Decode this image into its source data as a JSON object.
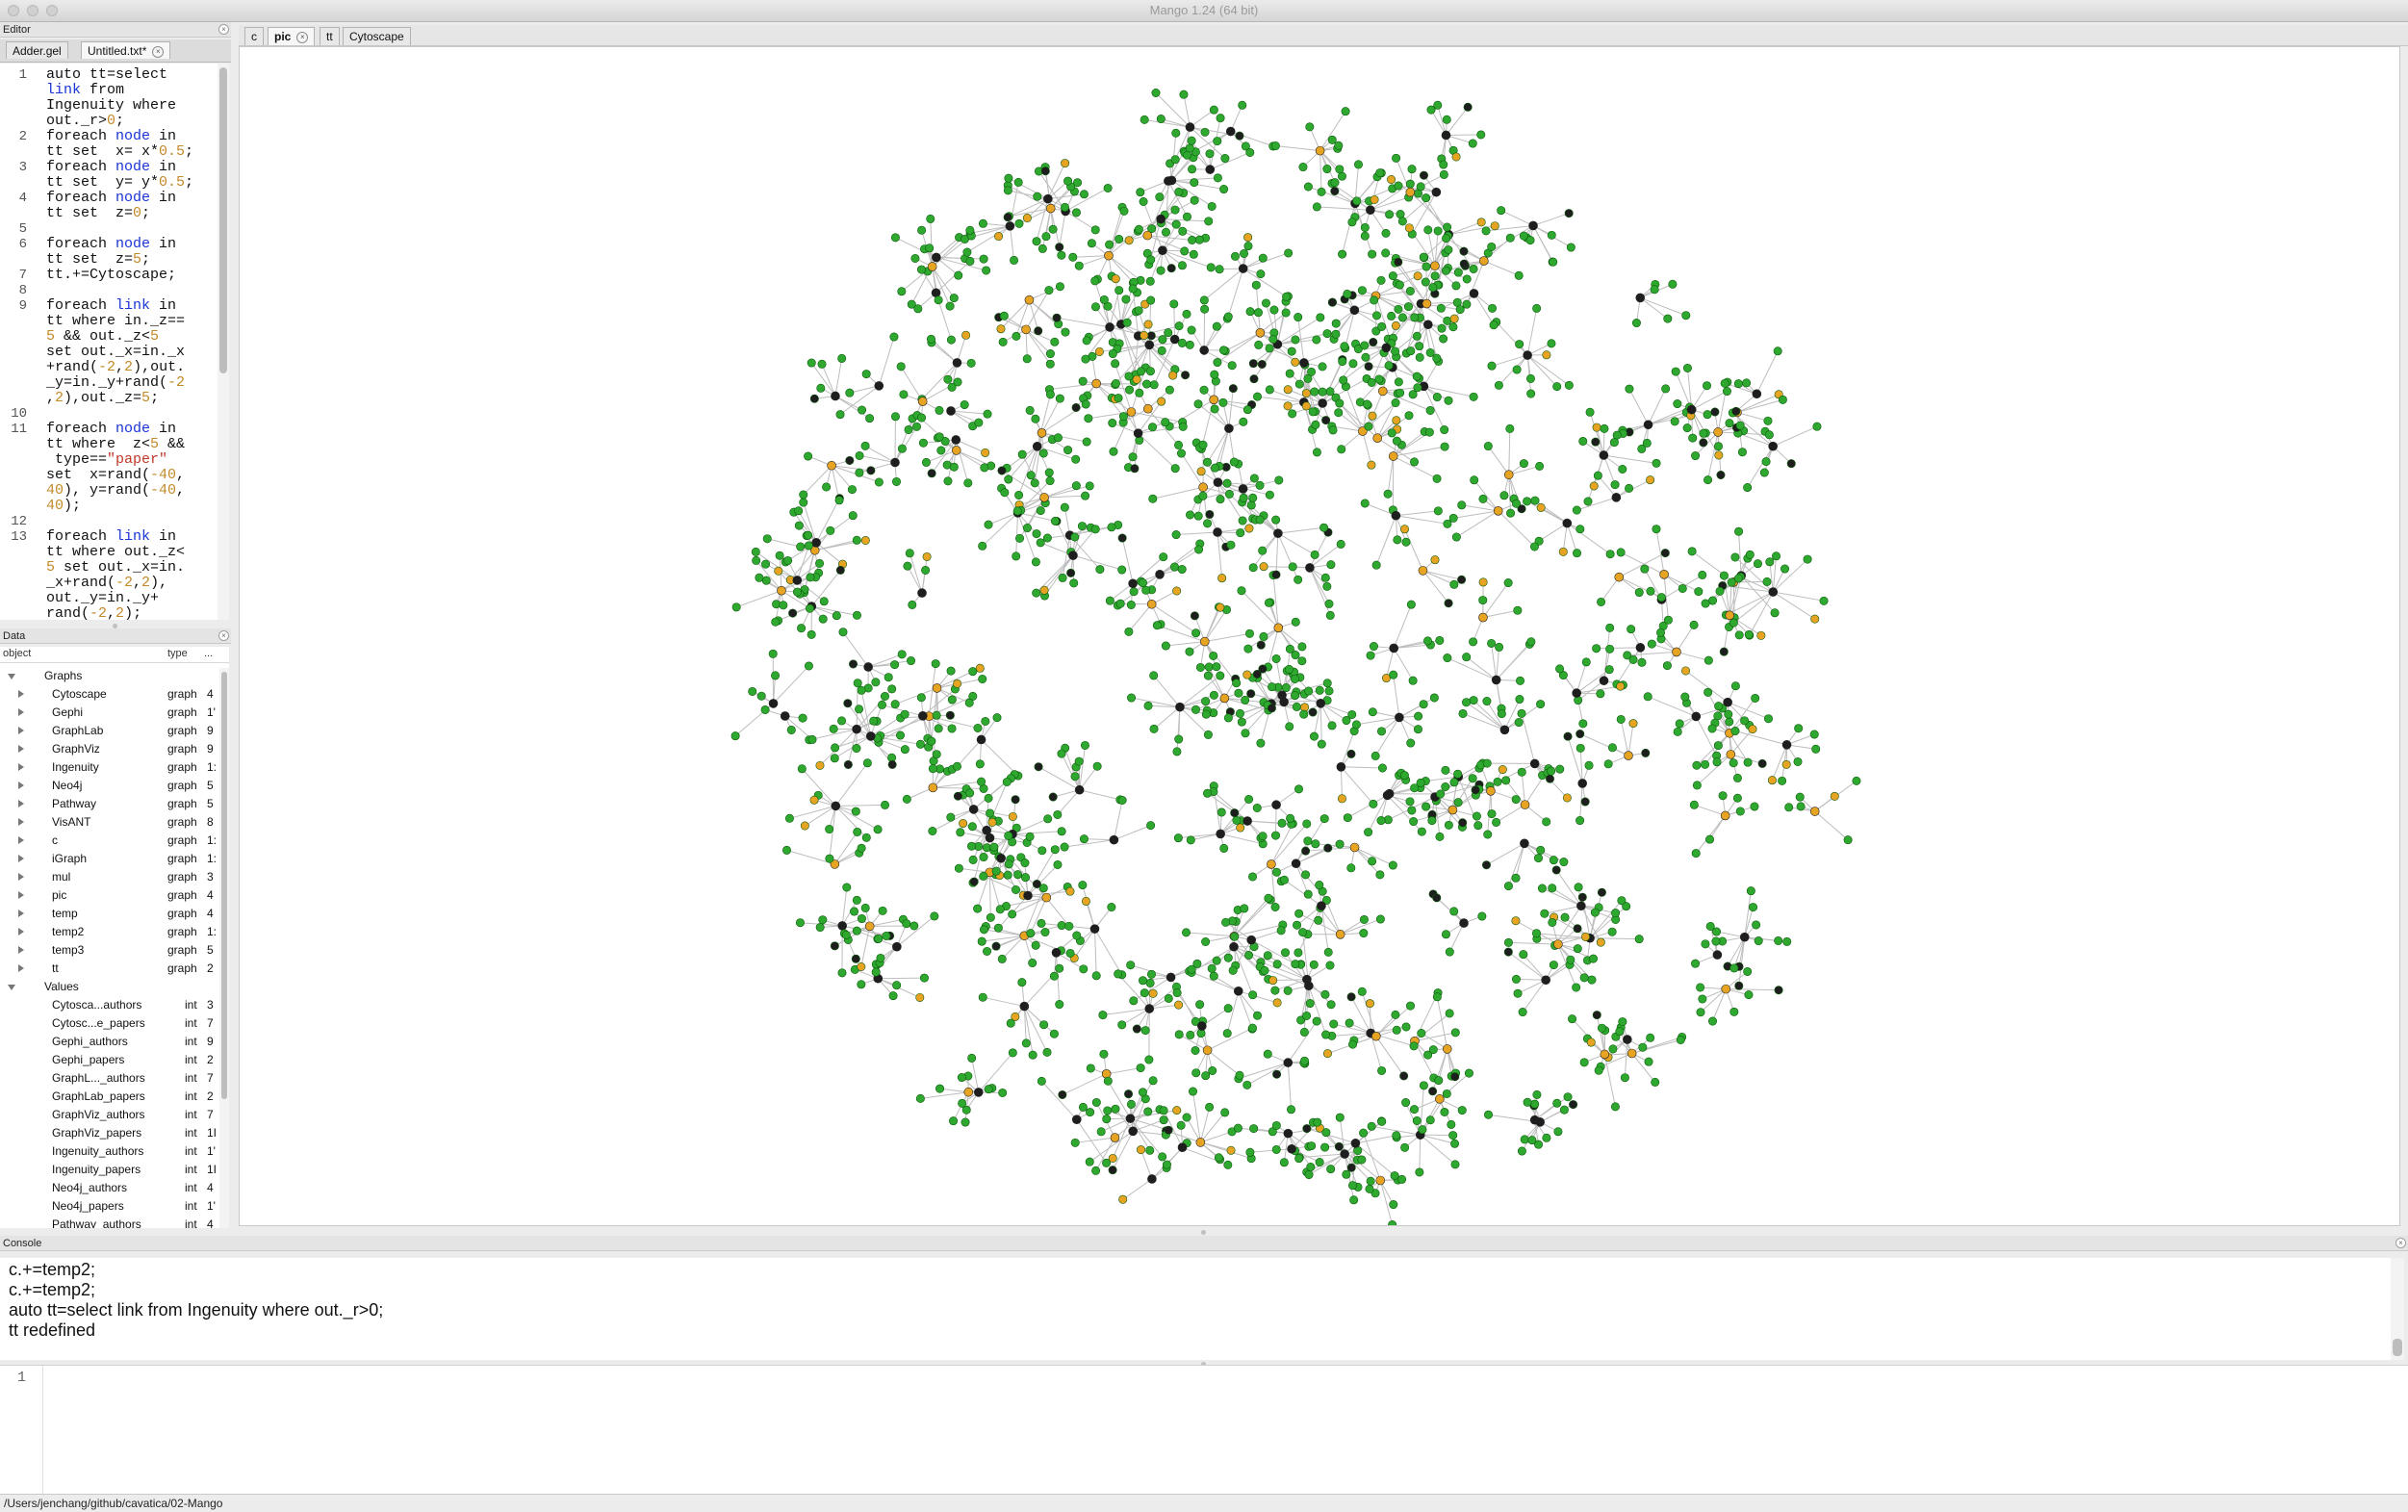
{
  "window": {
    "title": "Mango 1.24 (64 bit)"
  },
  "editor": {
    "panel_title": "Editor",
    "tabs": [
      {
        "label": "Adder.gel"
      },
      {
        "label": "Untitled.txt*"
      }
    ],
    "line_numbers": [
      "1",
      "2",
      "3",
      "4",
      "5",
      "6",
      "7",
      "8",
      "9",
      "10",
      "11",
      "12",
      "13"
    ],
    "code_lines": [
      "auto tt=select",
      "link from",
      "Ingenuity where",
      "out._r>0;",
      "foreach node in",
      "tt set  x= x*0.5;",
      "foreach node in",
      "tt set  y= y*0.5;",
      "foreach node in",
      "tt set  z=0;",
      "",
      "foreach node in",
      "tt set  z=5;",
      "tt.+=Cytoscape;",
      "",
      "foreach link in",
      "tt where in._z==",
      "5 && out._z<5",
      "set out._x=in._x",
      "+rand(-2,2),out.",
      "_y=in._y+rand(-2",
      ",2),out._z=5;",
      "",
      "foreach node in",
      "tt where  z<5 &&",
      " type==\"paper\"",
      "set  x=rand(-40,",
      "40), y=rand(-40,",
      "40);",
      "",
      "foreach link in",
      "tt where out._z<",
      "5 set out._x=in.",
      "_x+rand(-2,2),",
      "out._y=in._y+",
      "rand(-2,2);"
    ]
  },
  "data_panel": {
    "panel_title": "Data",
    "col_object": "object",
    "col_type": "type",
    "col_more": "...",
    "groups": [
      {
        "label": "Graphs"
      },
      {
        "label": "Values"
      }
    ],
    "graphs": [
      {
        "name": "Cytoscape",
        "type": "graph",
        "val": "4"
      },
      {
        "name": "Gephi",
        "type": "graph",
        "val": "1'"
      },
      {
        "name": "GraphLab",
        "type": "graph",
        "val": "9"
      },
      {
        "name": "GraphViz",
        "type": "graph",
        "val": "9"
      },
      {
        "name": "Ingenuity",
        "type": "graph",
        "val": "1:"
      },
      {
        "name": "Neo4j",
        "type": "graph",
        "val": "5"
      },
      {
        "name": "Pathway",
        "type": "graph",
        "val": "5"
      },
      {
        "name": "VisANT",
        "type": "graph",
        "val": "8"
      },
      {
        "name": "c",
        "type": "graph",
        "val": "1:"
      },
      {
        "name": "iGraph",
        "type": "graph",
        "val": "1:"
      },
      {
        "name": "mul",
        "type": "graph",
        "val": "3"
      },
      {
        "name": "pic",
        "type": "graph",
        "val": "4"
      },
      {
        "name": "temp",
        "type": "graph",
        "val": "4"
      },
      {
        "name": "temp2",
        "type": "graph",
        "val": "1:"
      },
      {
        "name": "temp3",
        "type": "graph",
        "val": "5"
      },
      {
        "name": "tt",
        "type": "graph",
        "val": "2"
      }
    ],
    "values": [
      {
        "name": "Cytosca...authors",
        "type": "int",
        "val": "3"
      },
      {
        "name": "Cytosc...e_papers",
        "type": "int",
        "val": "7"
      },
      {
        "name": "Gephi_authors",
        "type": "int",
        "val": "9"
      },
      {
        "name": "Gephi_papers",
        "type": "int",
        "val": "2"
      },
      {
        "name": "GraphL..._authors",
        "type": "int",
        "val": "7"
      },
      {
        "name": "GraphLab_papers",
        "type": "int",
        "val": "2"
      },
      {
        "name": "GraphViz_authors",
        "type": "int",
        "val": "7"
      },
      {
        "name": "GraphViz_papers",
        "type": "int",
        "val": "1I"
      },
      {
        "name": "Ingenuity_authors",
        "type": "int",
        "val": "1'"
      },
      {
        "name": "Ingenuity_papers",
        "type": "int",
        "val": "1I"
      },
      {
        "name": "Neo4j_authors",
        "type": "int",
        "val": "4"
      },
      {
        "name": "Neo4j_papers",
        "type": "int",
        "val": "1'"
      },
      {
        "name": "Pathway_authors",
        "type": "int",
        "val": "4"
      }
    ]
  },
  "main_tabs": [
    {
      "label": "c"
    },
    {
      "label": "pic"
    },
    {
      "label": "tt"
    },
    {
      "label": "Cytoscape"
    }
  ],
  "graph_view": {
    "node_colors": {
      "author": "#2ea82e",
      "paper": "#e7a422",
      "other": "#1e1e1e"
    },
    "edge_color": "#bdbdbd"
  },
  "console": {
    "panel_title": "Console",
    "lines": [
      "c.+=temp2;",
      "c.+=temp2;",
      "auto tt=select link from Ingenuity where out._r>0;",
      "tt redefined"
    ],
    "input_line_number": "1"
  },
  "status_bar": {
    "path": "/Users/jenchang/github/cavatica/02-Mango"
  }
}
